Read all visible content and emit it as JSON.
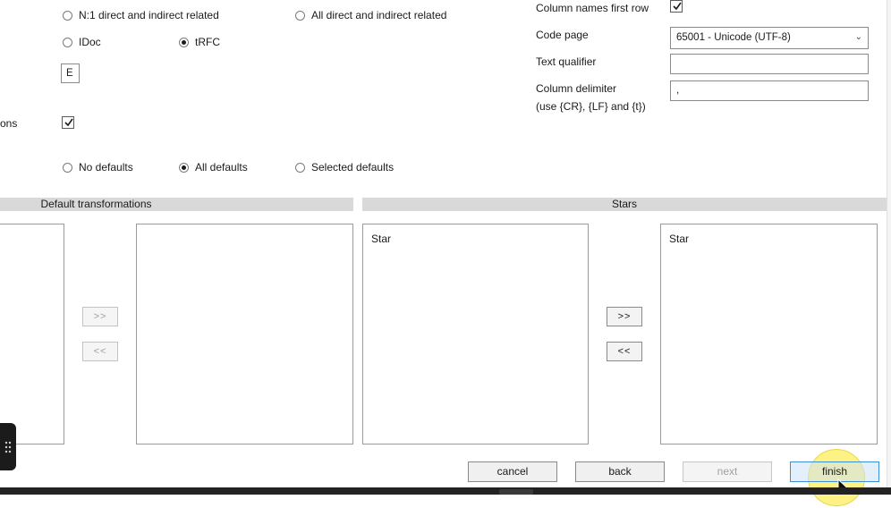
{
  "relations": {
    "n1_label": "N:1 direct and indirect related",
    "all_label": "All direct and indirect related",
    "idoc_label": "IDoc",
    "trfc_label": "tRFC",
    "small_field_value": "E"
  },
  "options": {
    "truncated_label": "ons",
    "no_defaults_label": "No defaults",
    "all_defaults_label": "All defaults",
    "selected_defaults_label": "Selected defaults"
  },
  "csv": {
    "column_names_label": "Column names first row",
    "code_page_label": "Code page",
    "code_page_value": "65001 - Unicode (UTF-8)",
    "text_qualifier_label": "Text qualifier",
    "text_qualifier_value": "",
    "column_delimiter_label": "Column delimiter",
    "column_delimiter_hint": "(use {CR}, {LF} and {t})",
    "column_delimiter_value": ","
  },
  "transformations": {
    "header": "Default transformations",
    "add_label": ">>",
    "remove_label": "<<"
  },
  "stars": {
    "header": "Stars",
    "available": [
      "Star"
    ],
    "selected": [
      "Star"
    ],
    "add_label": ">>",
    "remove_label": "<<"
  },
  "footer": {
    "cancel": "cancel",
    "back": "back",
    "next": "next",
    "finish": "finish"
  },
  "colors": {
    "accent": "#3c8fd6",
    "finish_bg": "#cce4f7",
    "highlight": "#fff59a"
  },
  "icons": {
    "drag_handle": "grip-dots-icon",
    "cursor": "mouse-pointer-icon"
  }
}
